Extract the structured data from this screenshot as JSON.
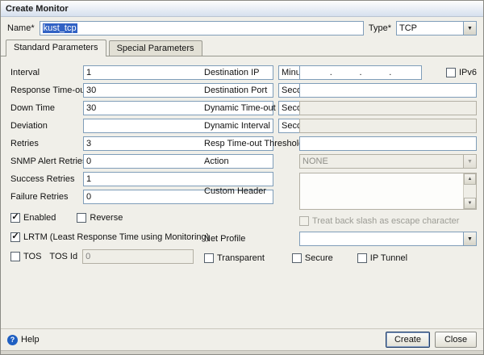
{
  "window": {
    "title": "Create Monitor"
  },
  "header": {
    "name_label": "Name*",
    "name_value": "kust_tcp",
    "type_label": "Type*",
    "type_value": "TCP"
  },
  "tabs": {
    "standard": "Standard Parameters",
    "special": "Special Parameters"
  },
  "left": {
    "interval": {
      "label": "Interval",
      "value": "1",
      "unit": "Minutes"
    },
    "response_timeout": {
      "label": "Response Time-out",
      "value": "30",
      "unit": "Seconds"
    },
    "down_time": {
      "label": "Down Time",
      "value": "30",
      "unit": "Seconds"
    },
    "deviation": {
      "label": "Deviation",
      "value": "",
      "unit": "Seconds"
    },
    "retries": {
      "label": "Retries",
      "value": "3"
    },
    "snmp_alert_retries": {
      "label": "SNMP Alert Retries",
      "value": "0"
    },
    "success_retries": {
      "label": "Success Retries",
      "value": "1"
    },
    "failure_retries": {
      "label": "Failure Retries",
      "value": "0"
    },
    "enabled_label": "Enabled",
    "reverse_label": "Reverse",
    "lrtm_label": "LRTM (Least Response Time using Monitoring)",
    "tos_label": "TOS",
    "tos_id_label": "TOS Id",
    "tos_id_value": "0"
  },
  "right": {
    "destination_ip": {
      "label": "Destination IP",
      "separator": "."
    },
    "ipv6_label": "IPv6",
    "destination_port": {
      "label": "Destination Port",
      "value": ""
    },
    "dynamic_timeout": {
      "label": "Dynamic Time-out",
      "value": ""
    },
    "dynamic_interval": {
      "label": "Dynamic Interval",
      "value": ""
    },
    "resp_timeout_threshold": {
      "label": "Resp Time-out Threshold",
      "value": ""
    },
    "action": {
      "label": "Action",
      "value": "NONE"
    },
    "custom_header": {
      "label": "Custom Header",
      "value": ""
    },
    "treat_backslash_label": "Treat back slash as escape character",
    "net_profile": {
      "label": "Net Profile",
      "value": ""
    },
    "transparent_label": "Transparent",
    "secure_label": "Secure",
    "ip_tunnel_label": "IP Tunnel"
  },
  "footer": {
    "help": "Help",
    "create": "Create",
    "close": "Close"
  },
  "icons": {
    "dropdown_arrow": "▼",
    "scroll_up": "▲",
    "scroll_down": "▼",
    "checkmark": "✓",
    "help": "?"
  },
  "colors": {
    "selection": "#3162c4",
    "title_text": "#1b1b1b",
    "help_icon": "#1f5fc2"
  }
}
